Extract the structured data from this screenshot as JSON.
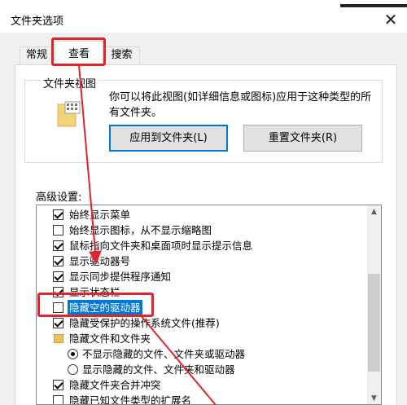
{
  "window": {
    "title": "文件夹选项",
    "close_glyph": "✕"
  },
  "tabs": [
    {
      "label": "常规"
    },
    {
      "label": "查看"
    },
    {
      "label": "搜索"
    }
  ],
  "folder_view": {
    "group_label": "文件夹视图",
    "description": "你可以将此视图(如详细信息或图标)应用于这种类型的所有文件夹。",
    "apply_button": "应用到文件夹(L)",
    "reset_button": "重置文件夹(R)"
  },
  "advanced": {
    "label": "高级设置:",
    "items": [
      {
        "type": "checkbox",
        "checked": true,
        "label": "始终显示菜单"
      },
      {
        "type": "checkbox",
        "checked": false,
        "label": "始终显示图标，从不显示缩略图"
      },
      {
        "type": "checkbox",
        "checked": true,
        "label": "鼠标指向文件夹和桌面项时显示提示信息"
      },
      {
        "type": "checkbox",
        "checked": true,
        "label": "显示驱动器号"
      },
      {
        "type": "checkbox",
        "checked": true,
        "label": "显示同步提供程序通知"
      },
      {
        "type": "checkbox",
        "checked": true,
        "label": "显示状态栏"
      },
      {
        "type": "checkbox",
        "checked": false,
        "label": "隐藏空的驱动器",
        "selected": true
      },
      {
        "type": "checkbox",
        "checked": true,
        "label": "隐藏受保护的操作系统文件(推荐)"
      },
      {
        "type": "folder",
        "label": "隐藏文件和文件夹"
      },
      {
        "type": "radio",
        "checked": true,
        "label": "不显示隐藏的文件、文件夹或驱动器"
      },
      {
        "type": "radio",
        "checked": false,
        "label": "显示隐藏的文件、文件夹和驱动器"
      },
      {
        "type": "checkbox",
        "checked": true,
        "label": "隐藏文件夹合并冲突"
      },
      {
        "type": "checkbox",
        "checked": false,
        "label": "隐藏已知文件类型的扩展名"
      }
    ]
  },
  "colors": {
    "highlight": "#e0242b",
    "selection": "#0078d7",
    "accent_button_border": "#0078d7"
  }
}
